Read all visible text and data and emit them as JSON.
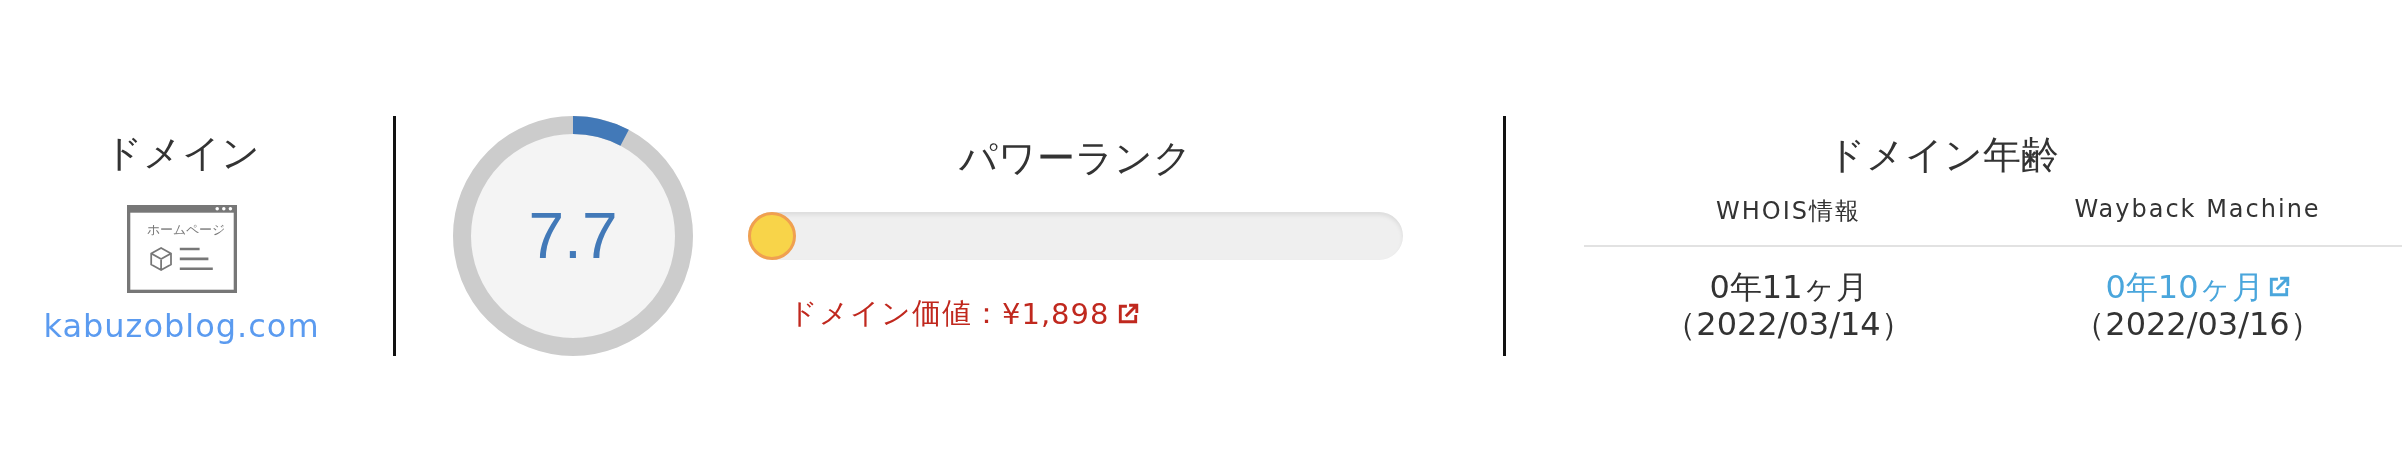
{
  "domain": {
    "title": "ドメイン",
    "icon_label": "ホームページ",
    "name": "kabuzoblog.com"
  },
  "power_rank": {
    "title": "パワーランク",
    "score": "7.7",
    "slider": {
      "level": 0
    },
    "value_label": "ドメイン価値：",
    "value": "¥1,898"
  },
  "domain_age": {
    "title": "ドメイン年齢",
    "columns": [
      {
        "header": "WHOIS情報",
        "age": "0年11ヶ月",
        "date": "（2022/03/14）",
        "link": false
      },
      {
        "header": "Wayback Machine",
        "age": "0年10ヶ月",
        "date": "（2022/03/16）",
        "link": true
      }
    ]
  }
}
